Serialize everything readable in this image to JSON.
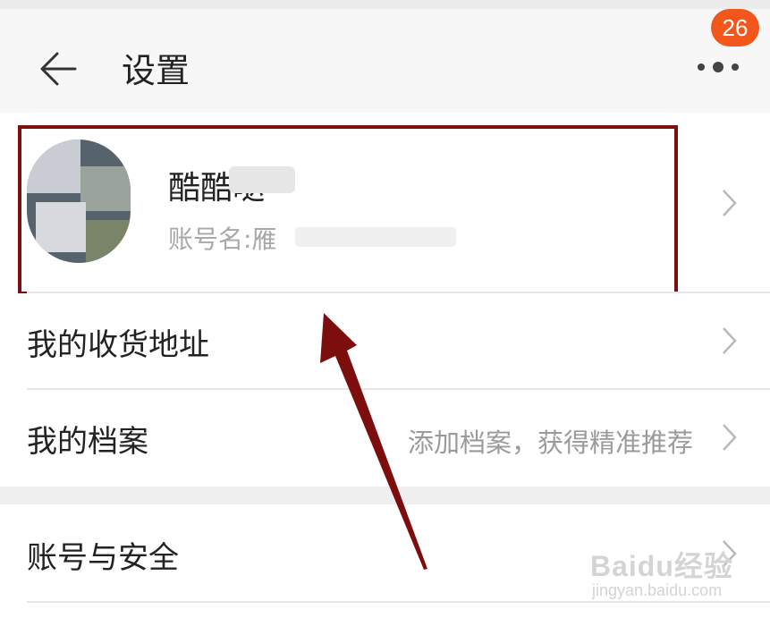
{
  "header": {
    "title": "设置",
    "back_icon": "back-arrow-icon",
    "more_icon": "more-dots-icon",
    "badge_count": "26",
    "badge_color": "#f2561b"
  },
  "profile": {
    "nickname": "酷酷哒",
    "account_label": "账号名:雁"
  },
  "menu": {
    "address": "我的收货地址",
    "archive": "我的档案",
    "archive_hint": "添加档案，获得精准推荐",
    "security": "账号与安全"
  },
  "annotation": {
    "highlight_color": "#7d0e0e"
  },
  "watermark": {
    "main": "Baidu经验",
    "sub": "jingyan.baidu.com"
  }
}
